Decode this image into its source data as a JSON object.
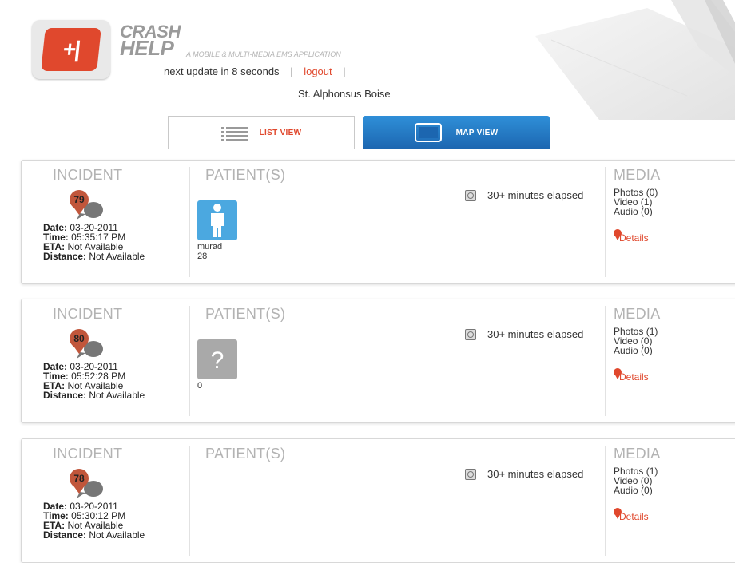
{
  "header": {
    "brand_line1": "CRASH",
    "brand_line2": "HELP",
    "logo_text": "+|",
    "tagline": "A MOBILE & MULTI-MEDIA EMS APPLICATION",
    "update_text": "next update in 8 seconds",
    "logout_label": "logout",
    "hospital": "St. Alphonsus Boise"
  },
  "tabs": [
    {
      "label": "LIST VIEW",
      "icon": "list-icon",
      "active": true
    },
    {
      "label": "MAP VIEW",
      "icon": "map-icon",
      "active": false
    }
  ],
  "columns": {
    "incident": "INCIDENT",
    "patients": "PATIENT(S)",
    "media": "MEDIA"
  },
  "labels": {
    "date": "Date:",
    "time": "Time:",
    "eta": "ETA:",
    "distance": "Distance:",
    "details": "Details"
  },
  "incidents": [
    {
      "id": "79",
      "date": "03-20-2011",
      "time": "05:35:17 PM",
      "eta": "Not Available",
      "distance": "Not Available",
      "patient_icon": "person-icon",
      "patient_name": "murad",
      "patient_age": "28",
      "elapsed": "30+ minutes elapsed",
      "photos": "Photos (0)",
      "video": "Video (1)",
      "audio": "Audio (0)"
    },
    {
      "id": "80",
      "date": "03-20-2011",
      "time": "05:52:28 PM",
      "eta": "Not Available",
      "distance": "Not Available",
      "patient_icon": "unknown-patient-icon",
      "patient_name": "",
      "patient_age": "0",
      "elapsed": "30+ minutes elapsed",
      "photos": "Photos (1)",
      "video": "Video (0)",
      "audio": "Audio (0)"
    },
    {
      "id": "78",
      "date": "03-20-2011",
      "time": "05:30:12 PM",
      "eta": "Not Available",
      "distance": "Not Available",
      "patient_icon": "",
      "patient_name": "",
      "patient_age": "",
      "elapsed": "30+ minutes elapsed",
      "photos": "Photos (1)",
      "video": "Video (0)",
      "audio": "Audio (0)"
    }
  ],
  "colors": {
    "accent": "#e0482d",
    "map_tab": "#1f74c2",
    "patient_blue": "#4ba8e0",
    "unknown_gray": "#a9a9a9"
  }
}
